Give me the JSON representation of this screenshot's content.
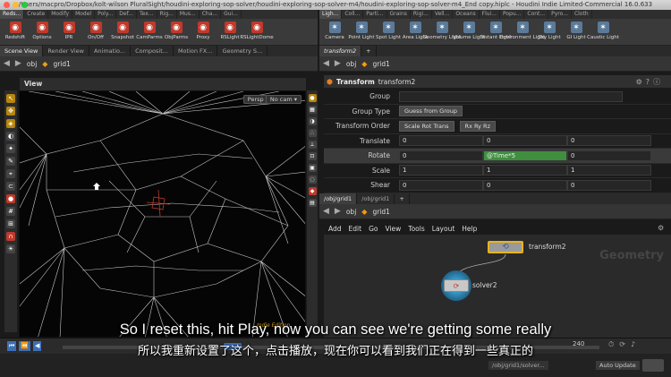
{
  "window": {
    "title": "/Users/macpro/Dropbox/kolt-wilson PluralSight/houdini-exploring-sop-solver/houdini-exploring-sop-solver-m4/houdini-exploring-sop-solver-m4_End copy.hiplc - Houdini Indie Limited-Commercial 16.0.633"
  },
  "left_shelf": {
    "tabs": [
      "Reds...",
      "Create",
      "Modify",
      "Model",
      "Poly...",
      "Def...",
      "Tex...",
      "Rig...",
      "Mus...",
      "Cha...",
      "Gui..."
    ],
    "tools": [
      {
        "label": "Redshift",
        "color": "#c0392b",
        "icon": "redshift-icon"
      },
      {
        "label": "Options",
        "color": "#c0392b",
        "icon": "options-icon"
      },
      {
        "label": "IPR",
        "color": "#c0392b",
        "icon": "ipr-icon"
      },
      {
        "label": "On/Off",
        "color": "#c0392b",
        "icon": "onoff-icon"
      },
      {
        "label": "Snapshot",
        "color": "#c0392b",
        "icon": "snapshot-icon"
      },
      {
        "label": "CamParms",
        "color": "#c0392b",
        "icon": "camparms-icon"
      },
      {
        "label": "ObjParms",
        "color": "#c0392b",
        "icon": "objparms-icon"
      },
      {
        "label": "Proxy",
        "color": "#c0392b",
        "icon": "proxy-icon"
      },
      {
        "label": "RSLight",
        "color": "#c0392b",
        "icon": "rslight-icon"
      },
      {
        "label": "RSLightDome",
        "color": "#c0392b",
        "icon": "rslightdome-icon"
      }
    ]
  },
  "right_shelf": {
    "tabs": [
      "Ligh...",
      "Coll...",
      "Parti...",
      "Grains",
      "Rigi...",
      "Vell...",
      "Oceans",
      "Flui...",
      "Popu...",
      "Cont...",
      "Pyro...",
      "Cloth"
    ],
    "tools": [
      {
        "label": "Camera",
        "icon": "camera-icon"
      },
      {
        "label": "Point Light",
        "icon": "point-light-icon"
      },
      {
        "label": "Spot Light",
        "icon": "spot-light-icon"
      },
      {
        "label": "Area Light",
        "icon": "area-light-icon"
      },
      {
        "label": "Geometry Light",
        "icon": "geometry-light-icon"
      },
      {
        "label": "Volume Light",
        "icon": "volume-light-icon"
      },
      {
        "label": "Distant Light",
        "icon": "distant-light-icon"
      },
      {
        "label": "Environment Light",
        "icon": "environment-light-icon"
      },
      {
        "label": "Sky Light",
        "icon": "sky-light-icon"
      },
      {
        "label": "GI Light",
        "icon": "gi-light-icon"
      },
      {
        "label": "Caustic Light",
        "icon": "caustic-light-icon"
      }
    ]
  },
  "left_pane": {
    "tabs": [
      "Scene View",
      "Render View",
      "Animatio...",
      "Composit...",
      "Motion FX...",
      "Geometry S..."
    ],
    "path": {
      "obj": "obj",
      "node": "grid1"
    },
    "viewport": {
      "label": "View",
      "camera": "Persp ▾",
      "cam_menu": "No cam ▾"
    }
  },
  "param_pane": {
    "tab": "transform2",
    "path": {
      "obj": "obj",
      "node": "grid1"
    },
    "node_type": "Transform",
    "node_name": "transform2",
    "rows": [
      {
        "label": "Group",
        "values": [
          ""
        ]
      },
      {
        "label": "Group Type",
        "values": [
          "Guess from Group"
        ]
      },
      {
        "label": "Transform Order",
        "values": [
          "Scale Rot Trans",
          "Rx Ry Rz"
        ]
      },
      {
        "label": "Translate",
        "values": [
          "0",
          "0",
          "0"
        ]
      },
      {
        "label": "Rotate",
        "values": [
          "0",
          "@Time*5",
          "0"
        ]
      },
      {
        "label": "Scale",
        "values": [
          "1",
          "1",
          "1"
        ]
      },
      {
        "label": "Shear",
        "values": [
          "0",
          "0",
          "0"
        ]
      }
    ]
  },
  "network_pane": {
    "tabs": [
      "/obj/grid1",
      "/obj/grid1"
    ],
    "path": {
      "obj": "obj",
      "node": "grid1"
    },
    "menu": [
      "Add",
      "Edit",
      "Go",
      "View",
      "Tools",
      "Layout",
      "Help"
    ],
    "watermark": "Geometry",
    "nodes": [
      {
        "name": "transform2",
        "kind": "transform"
      },
      {
        "name": "solver2",
        "kind": "solver"
      }
    ],
    "status_path": "/obj/grid1/solver...",
    "auto_update": "Auto Update"
  },
  "timeline": {
    "end_frame": "240",
    "watermark_text": "Indie Edition"
  },
  "captions": {
    "en": "So I reset this, hit Play, now you can see we're getting some really",
    "zh": "所以我重新设置了这个，点击播放，现在你可以看到我们正在得到一些真正的"
  }
}
